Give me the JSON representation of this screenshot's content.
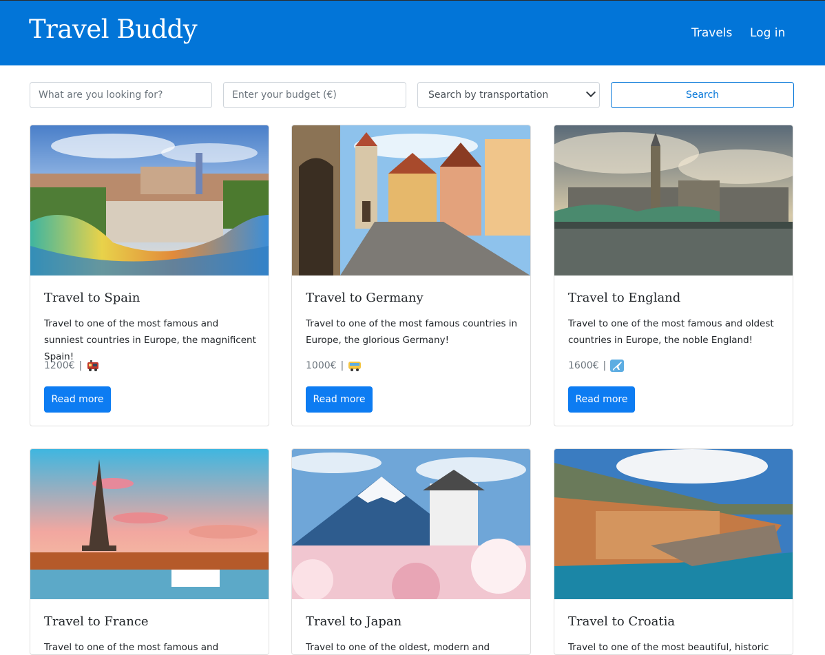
{
  "nav": {
    "brand": "Travel Buddy",
    "links": [
      "Travels",
      "Log in"
    ]
  },
  "search": {
    "what_placeholder": "What are you looking for?",
    "budget_placeholder": "Enter your budget (€)",
    "transport_selected": "Search by transportation",
    "button_label": "Search"
  },
  "cards": [
    {
      "title": "Travel to Spain",
      "text": "Travel to one of the most famous and sunniest countries in Europe, the magnificent Spain!",
      "price": "1200€",
      "separator": "|",
      "transport_icon": "train-icon",
      "button": "Read more"
    },
    {
      "title": "Travel to Germany",
      "text": "Travel to one of the most famous countries in Europe, the glorious Germany!",
      "price": "1000€",
      "separator": "|",
      "transport_icon": "bus-icon",
      "button": "Read more"
    },
    {
      "title": "Travel to England",
      "text": "Travel to one of the most famous and oldest countries in Europe, the noble England!",
      "price": "1600€",
      "separator": "|",
      "transport_icon": "airplane-icon",
      "button": "Read more"
    },
    {
      "title": "Travel to France",
      "text": "Travel to one of the most famous and romantic"
    },
    {
      "title": "Travel to Japan",
      "text": "Travel to one of the oldest, modern and"
    },
    {
      "title": "Travel to Croatia",
      "text": "Travel to one of the most beautiful, historic"
    }
  ],
  "colors": {
    "navbar": "#0275d8",
    "primary_button": "#0d7cf2"
  }
}
